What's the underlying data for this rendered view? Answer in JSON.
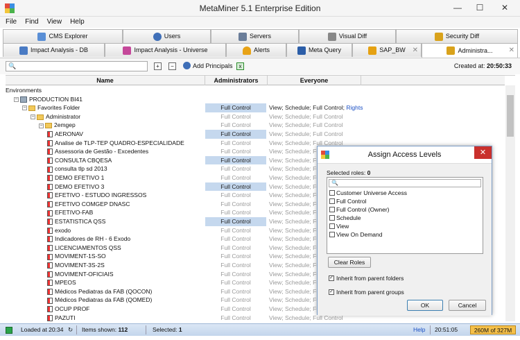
{
  "window": {
    "title": "MetaMiner 5.1 Enterprise Edition",
    "minimize": "—",
    "maximize": "☐",
    "close": "✕"
  },
  "menu": [
    "File",
    "Find",
    "View",
    "Help"
  ],
  "tabs_row1": [
    {
      "label": "CMS Explorer",
      "icon": "cms-icon"
    },
    {
      "label": "Users",
      "icon": "users-icon"
    },
    {
      "label": "Servers",
      "icon": "servers-icon"
    },
    {
      "label": "Visual Diff",
      "icon": "diff-icon"
    },
    {
      "label": "Security Diff",
      "icon": "key-icon"
    }
  ],
  "tabs_row2": [
    {
      "label": "Impact Analysis - DB",
      "icon": "database-icon"
    },
    {
      "label": "Impact Analysis - Universe",
      "icon": "universe-icon"
    },
    {
      "label": "Alerts",
      "icon": "bell-icon"
    },
    {
      "label": "Meta Query",
      "icon": "sql-icon"
    },
    {
      "label": "SAP_BW",
      "icon": "sap-icon",
      "close": "✕"
    },
    {
      "label": "Administra...",
      "icon": "key-icon",
      "close": "✕"
    }
  ],
  "toolbar": {
    "add_principals": "Add Principals",
    "created_label": "Created at:",
    "created_time": "20:50:33"
  },
  "grid": {
    "headers": [
      "Name",
      "Administrators",
      "Everyone"
    ],
    "rows": [
      {
        "name": "Environments",
        "admin": "",
        "everyone": "",
        "indent": 0,
        "kind": "none",
        "exp": ""
      },
      {
        "name": "PRODUCTION BI41",
        "admin": "",
        "everyone": "",
        "indent": 1,
        "kind": "server",
        "exp": "−"
      },
      {
        "name": "Favorites Folder",
        "admin": "Full Control",
        "everyone": "View; Schedule; Full Control;",
        "rights": "Rights",
        "indent": 2,
        "kind": "folder",
        "exp": "−",
        "sel": true,
        "dark": true
      },
      {
        "name": "Administrator",
        "admin": "Full Control",
        "everyone": "View; Schedule; Full Control",
        "indent": 3,
        "kind": "folder",
        "exp": "−"
      },
      {
        "name": "2emgep",
        "admin": "Full Control",
        "everyone": "View; Schedule; Full Control",
        "indent": 4,
        "kind": "folder",
        "exp": "−"
      },
      {
        "name": "AERONAV",
        "admin": "Full Control",
        "everyone": "View; Schedule; Full Control",
        "indent": 5,
        "kind": "doc",
        "sel": true
      },
      {
        "name": "Analise de TLP-TEP QUADRO-ESPECIALIDADE",
        "admin": "Full Control",
        "everyone": "View; Schedule; Full Control",
        "indent": 5,
        "kind": "doc"
      },
      {
        "name": "Assessoria de Gestão - Excedentes",
        "admin": "Full Control",
        "everyone": "View; Schedule; Full Control",
        "indent": 5,
        "kind": "doc"
      },
      {
        "name": "CONSULTA CBQESA",
        "admin": "Full Control",
        "everyone": "View; Schedule; Full Control",
        "indent": 5,
        "kind": "doc",
        "sel": true
      },
      {
        "name": "consulta tlp sd 2013",
        "admin": "Full Control",
        "everyone": "View; Schedule; Full Control",
        "indent": 5,
        "kind": "doc"
      },
      {
        "name": "DEMO EFETIVO 1",
        "admin": "Full Control",
        "everyone": "View; Schedule; Full Control",
        "indent": 5,
        "kind": "doc"
      },
      {
        "name": "DEMO EFETIVO 3",
        "admin": "Full Control",
        "everyone": "View; Schedule; Full Control",
        "indent": 5,
        "kind": "doc",
        "sel": true
      },
      {
        "name": "EFETIVO - ESTUDO INGRESSOS",
        "admin": "Full Control",
        "everyone": "View; Schedule; Full Control",
        "indent": 5,
        "kind": "doc"
      },
      {
        "name": "EFETIVO COMGEP DNASC",
        "admin": "Full Control",
        "everyone": "View; Schedule; Full Control",
        "indent": 5,
        "kind": "doc"
      },
      {
        "name": "EFETIVO-FAB",
        "admin": "Full Control",
        "everyone": "View; Schedule; Full Control",
        "indent": 5,
        "kind": "doc"
      },
      {
        "name": "ESTATISTICA QSS",
        "admin": "Full Control",
        "everyone": "View; Schedule; Full Control",
        "indent": 5,
        "kind": "doc",
        "sel": true
      },
      {
        "name": "exodo",
        "admin": "Full Control",
        "everyone": "View; Schedule; Full Control",
        "indent": 5,
        "kind": "doc"
      },
      {
        "name": "Indicadores de RH - 6 Exodo",
        "admin": "Full Control",
        "everyone": "View; Schedule; Full Control",
        "indent": 5,
        "kind": "doc"
      },
      {
        "name": "LICENCIAMENTOS QSS",
        "admin": "Full Control",
        "everyone": "View; Schedule; Full Control",
        "indent": 5,
        "kind": "doc"
      },
      {
        "name": "MOVIMENT-1S-SO",
        "admin": "Full Control",
        "everyone": "View; Schedule; Full Control",
        "indent": 5,
        "kind": "doc"
      },
      {
        "name": "MOVIMENT-3S-2S",
        "admin": "Full Control",
        "everyone": "View; Schedule; Full Control",
        "indent": 5,
        "kind": "doc"
      },
      {
        "name": "MOVIMENT-OFICIAIS",
        "admin": "Full Control",
        "everyone": "View; Schedule; Full Control",
        "indent": 5,
        "kind": "doc"
      },
      {
        "name": "MPEOS",
        "admin": "Full Control",
        "everyone": "View; Schedule; Full Control",
        "indent": 5,
        "kind": "doc"
      },
      {
        "name": "Médicos Pediatras da FAB (QOCON)",
        "admin": "Full Control",
        "everyone": "View; Schedule; Full Control",
        "indent": 5,
        "kind": "doc"
      },
      {
        "name": "Médicos Pediatras da FAB (QOMED)",
        "admin": "Full Control",
        "everyone": "View; Schedule; Full Control",
        "indent": 5,
        "kind": "doc"
      },
      {
        "name": "OCUP PROF",
        "admin": "Full Control",
        "everyone": "View; Schedule; Full Control",
        "indent": 5,
        "kind": "doc"
      },
      {
        "name": "PAZUTI",
        "admin": "Full Control",
        "everyone": "View; Schedule; Full Control",
        "indent": 5,
        "kind": "doc"
      }
    ]
  },
  "dialog": {
    "title": "Assign Access Levels",
    "selected_label": "Selected roles:",
    "selected_count": "0",
    "roles": [
      "Customer Universe Access",
      "Full Control",
      "Full Control (Owner)",
      "Schedule",
      "View",
      "View On Demand"
    ],
    "clear_roles": "Clear Roles",
    "inherit_folders": "Inherit from parent folders",
    "inherit_groups": "Inherit from parent groups",
    "ok": "OK",
    "cancel": "Cancel"
  },
  "status": {
    "loaded": "Loaded at 20:34",
    "items_label": "Items shown:",
    "items_count": "112",
    "selected_label": "Selected:",
    "selected_count": "1",
    "help": "Help",
    "time": "20:51:05",
    "memory": "260M of 327M"
  }
}
